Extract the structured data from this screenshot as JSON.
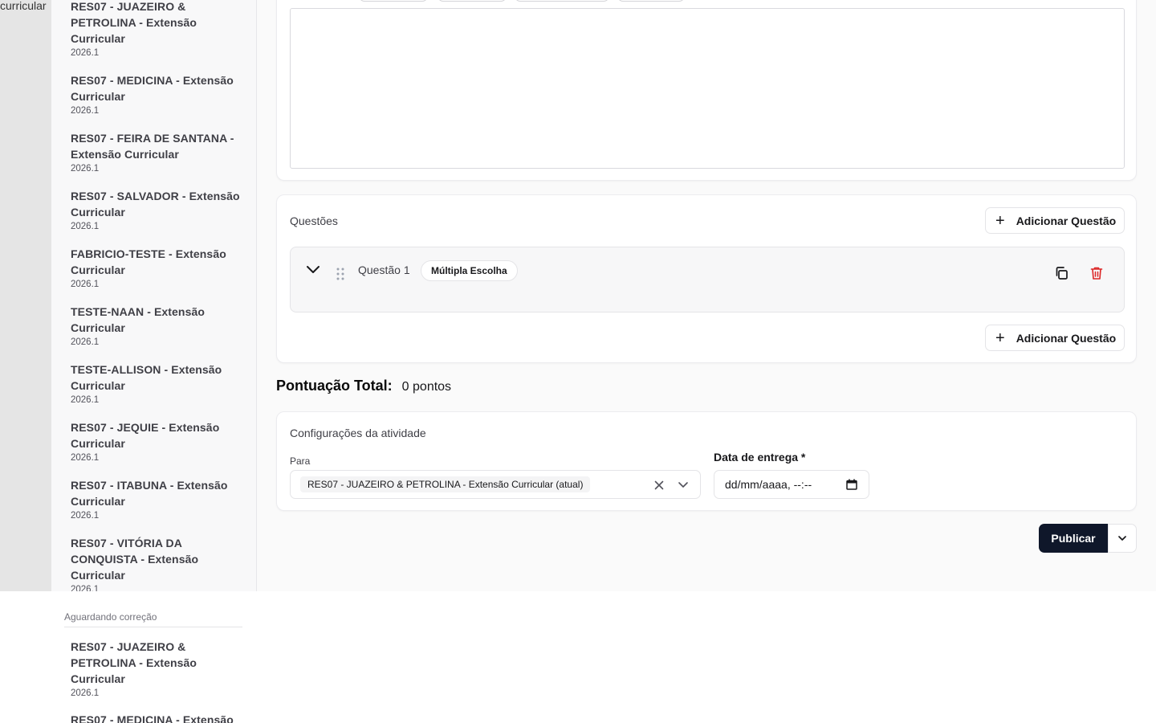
{
  "rail": {
    "text": "curricular"
  },
  "sidebar": {
    "items": [
      {
        "title": "RES07 - JUAZEIRO & PETROLINA - Extensão Curricular",
        "period": "2026.1"
      },
      {
        "title": "RES07 - MEDICINA - Extensão Curricular",
        "period": "2026.1"
      },
      {
        "title": "RES07 - FEIRA DE SANTANA - Extensão Curricular",
        "period": "2026.1"
      },
      {
        "title": "RES07 - SALVADOR - Extensão Curricular",
        "period": "2026.1"
      },
      {
        "title": "FABRICIO-TESTE - Extensão Curricular",
        "period": "2026.1"
      },
      {
        "title": "TESTE-NAAN - Extensão Curricular",
        "period": "2026.1"
      },
      {
        "title": "TESTE-ALLISON - Extensão Curricular",
        "period": "2026.1"
      },
      {
        "title": "RES07 - JEQUIE - Extensão Curricular",
        "period": "2026.1"
      },
      {
        "title": "RES07 - ITABUNA - Extensão Curricular",
        "period": "2026.1"
      },
      {
        "title": "RES07 - VITÓRIA DA CONQUISTA - Extensão Curricular",
        "period": "2026.1"
      }
    ],
    "awaiting_label": "Aguardando correção",
    "awaiting_items": [
      {
        "title": "RES07 - JUAZEIRO & PETROLINA - Extensão Curricular",
        "period": "2026.1"
      },
      {
        "title": "RES07 - MEDICINA - Extensão",
        "period": ""
      }
    ]
  },
  "questions": {
    "title": "Questões",
    "add_label": "Adicionar Questão",
    "items": [
      {
        "name": "Questão 1",
        "type": "Múltipla Escolha"
      }
    ]
  },
  "total": {
    "label": "Pontuação Total:",
    "value": "0 pontos"
  },
  "config": {
    "title": "Configurações da atividade",
    "para_label": "Para",
    "para_value": "RES07 - JUAZEIRO & PETROLINA - Extensão Curricular (atual)",
    "date_label": "Data de entrega *",
    "date_placeholder": "dd/mm/aaaa, --:--"
  },
  "actions": {
    "publish_label": "Publicar"
  },
  "colors": {
    "primary": "#0f172a",
    "danger": "#dc2626",
    "sidebar_bg": "#f8f8f9",
    "rail_bg": "#e5e5e5"
  },
  "icons": [
    "chevron-down-icon",
    "grip-icon",
    "copy-icon",
    "trash-icon",
    "plus-icon",
    "close-icon",
    "calendar-icon"
  ]
}
